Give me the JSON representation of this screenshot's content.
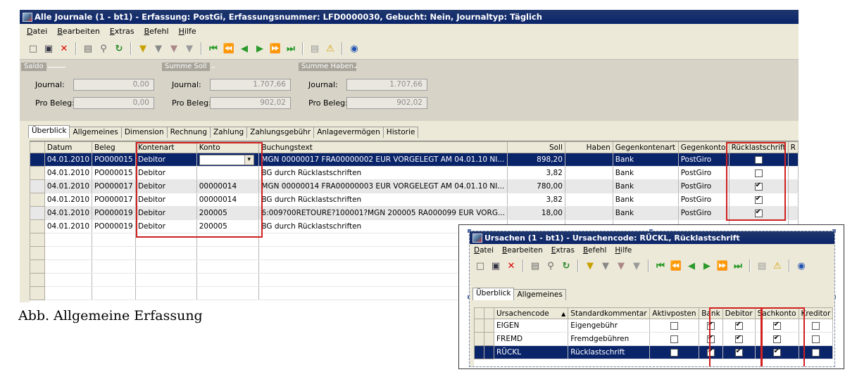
{
  "main": {
    "title": "Alle Journale (1 - bt1) - Erfassung: PostGi, Erfassungsnummer: LFD0000030, Gebucht: Nein, Journaltyp: Täglich",
    "menu": [
      "Datei",
      "Bearbeiten",
      "Extras",
      "Befehl",
      "Hilfe"
    ],
    "summary": {
      "saldo": {
        "label": "Saldo",
        "journal": "0,00",
        "pro_beleg": "0,00"
      },
      "soll": {
        "label": "Summe Soll",
        "journal": "1.707,66",
        "pro_beleg": "902,02"
      },
      "haben": {
        "label": "Summe Haben",
        "journal": "1.707,66",
        "pro_beleg": "902,02"
      },
      "journal_label": "Journal:",
      "pro_beleg_label": "Pro Beleg:"
    },
    "tabs": [
      "Überblick",
      "Allgemeines",
      "Dimension",
      "Rechnung",
      "Zahlung",
      "Zahlungsgebühr",
      "Anlagevermögen",
      "Historie"
    ],
    "columns": [
      "Datum",
      "Beleg",
      "Kontenart",
      "Konto",
      "Buchungstext",
      "Soll",
      "Haben",
      "Gegenkontenart",
      "Gegenkonto",
      "Rücklastschrift",
      "R"
    ],
    "rows": [
      {
        "datum": "04.01.2010",
        "beleg": "PO000015",
        "kontenart": "Debitor",
        "konto": "",
        "text": "MGN 00000017 FRA00000002      EUR VORGELEGT AM 04.01.10 NI...",
        "soll": "898,20",
        "haben": "",
        "gegenart": "Bank",
        "gegenkonto": "PostGiro",
        "ruecklast": false
      },
      {
        "datum": "04.01.2010",
        "beleg": "PO000015",
        "kontenart": "Debitor",
        "konto": "",
        "text": "BG durch Rücklastschriften",
        "soll": "3,82",
        "haben": "",
        "gegenart": "Bank",
        "gegenkonto": "PostGiro",
        "ruecklast": false
      },
      {
        "datum": "04.01.2010",
        "beleg": "PO000017",
        "kontenart": "Debitor",
        "konto": "00000014",
        "text": "MGN 00000014 FRA00000003      EUR VORGELEGT AM 04.01.10 NI...",
        "soll": "780,00",
        "haben": "",
        "gegenart": "Bank",
        "gegenkonto": "PostGiro",
        "ruecklast": true
      },
      {
        "datum": "04.01.2010",
        "beleg": "PO000017",
        "kontenart": "Debitor",
        "konto": "00000014",
        "text": "BG durch Rücklastschriften",
        "soll": "3,82",
        "haben": "",
        "gegenart": "Bank",
        "gegenkonto": "PostGiro",
        "ruecklast": true
      },
      {
        "datum": "04.01.2010",
        "beleg": "PO000019",
        "kontenart": "Debitor",
        "konto": "200005",
        "text": "6:009?00RETOURE?100001?MGN 200005 RA000099      EUR VORG...",
        "soll": "18,00",
        "haben": "",
        "gegenart": "Bank",
        "gegenkonto": "PostGiro",
        "ruecklast": true
      },
      {
        "datum": "04.01.2010",
        "beleg": "PO000019",
        "kontenart": "Debitor",
        "konto": "200005",
        "text": "BG durch Rücklastschriften",
        "soll": "",
        "haben": "",
        "gegenart": "",
        "gegenkonto": "",
        "ruecklast": false
      }
    ]
  },
  "caption": "Abb. Allgemeine Erfassung",
  "sub": {
    "title": "Ursachen (1 - bt1) - Ursachencode: RÜCKL, Rücklastschrift",
    "menu": [
      "Datei",
      "Bearbeiten",
      "Extras",
      "Befehl",
      "Hilfe"
    ],
    "tabs": [
      "Überblick",
      "Allgemeines"
    ],
    "columns": [
      "Ursachencode",
      "Standardkommentar",
      "Aktivposten",
      "Bank",
      "Debitor",
      "Sachkonto",
      "Kreditor"
    ],
    "sort_indicator": "▲",
    "rows": [
      {
        "code": "EIGEN",
        "kommentar": "Eigengebühr",
        "aktiv": false,
        "bank": true,
        "debitor": true,
        "sachkonto": true,
        "kreditor": false
      },
      {
        "code": "FREMD",
        "kommentar": "Fremdgebühren",
        "aktiv": false,
        "bank": true,
        "debitor": true,
        "sachkonto": true,
        "kreditor": false
      },
      {
        "code": "RÜCKL",
        "kommentar": "Rücklastschrift",
        "aktiv": false,
        "bank": true,
        "debitor": true,
        "sachkonto": true,
        "kreditor": false
      }
    ]
  },
  "colors": {
    "titlebar": "#0a246a",
    "highlight": "#d02020",
    "window": "#ece9d8"
  }
}
